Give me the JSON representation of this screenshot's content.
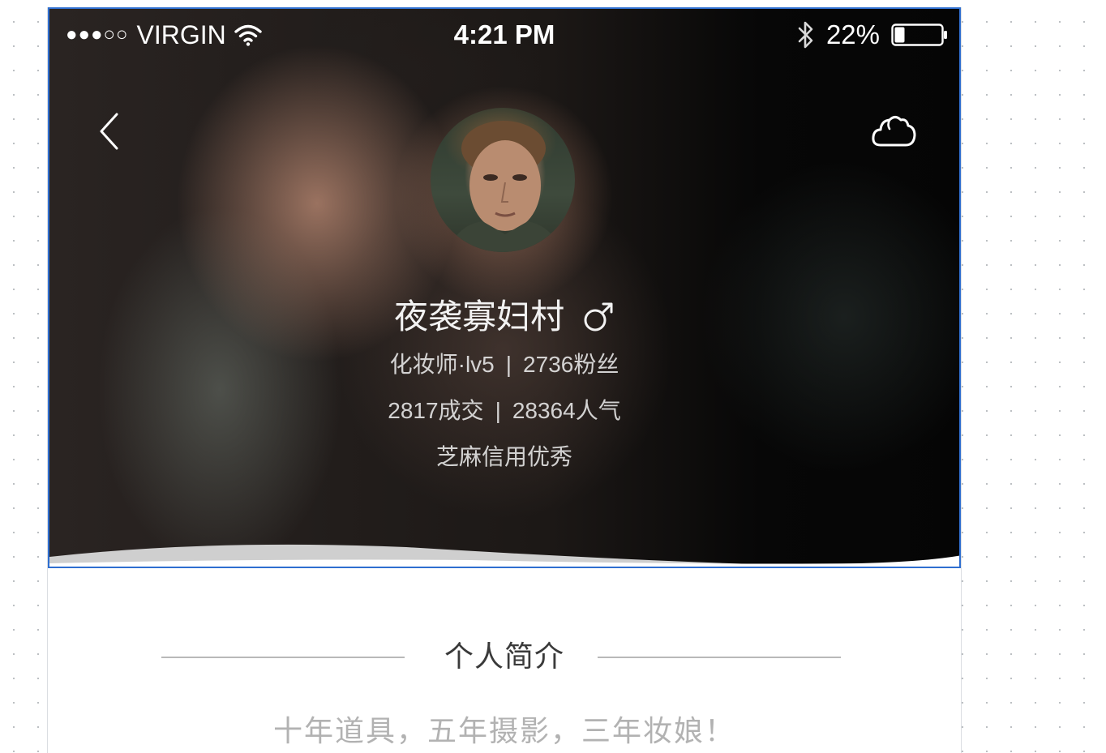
{
  "status_bar": {
    "signal": "●●●○○",
    "carrier": "VIRGIN",
    "time": "4:21 PM",
    "battery": "22%",
    "battery_level": 0.22
  },
  "header": {
    "back_icon": "chevron-left-icon",
    "share_icon": "cloud-icon"
  },
  "profile": {
    "nickname": "夜袭寡妇村",
    "gender_icon": "male-icon",
    "role": "化妆师·lv5",
    "fans": "2736粉丝",
    "deals": "2817成交",
    "popularity": "28364人气",
    "credit": "芝麻信用优秀",
    "separator": "|"
  },
  "intro": {
    "title": "个人简介",
    "text": "十年道具，五年摄影，三年妆娘！"
  },
  "colors": {
    "selection_border": "#2f6fd0",
    "text_light": "#f2f2f2",
    "intro_title": "#3a3a3a",
    "intro_text": "#b2b2b2"
  }
}
